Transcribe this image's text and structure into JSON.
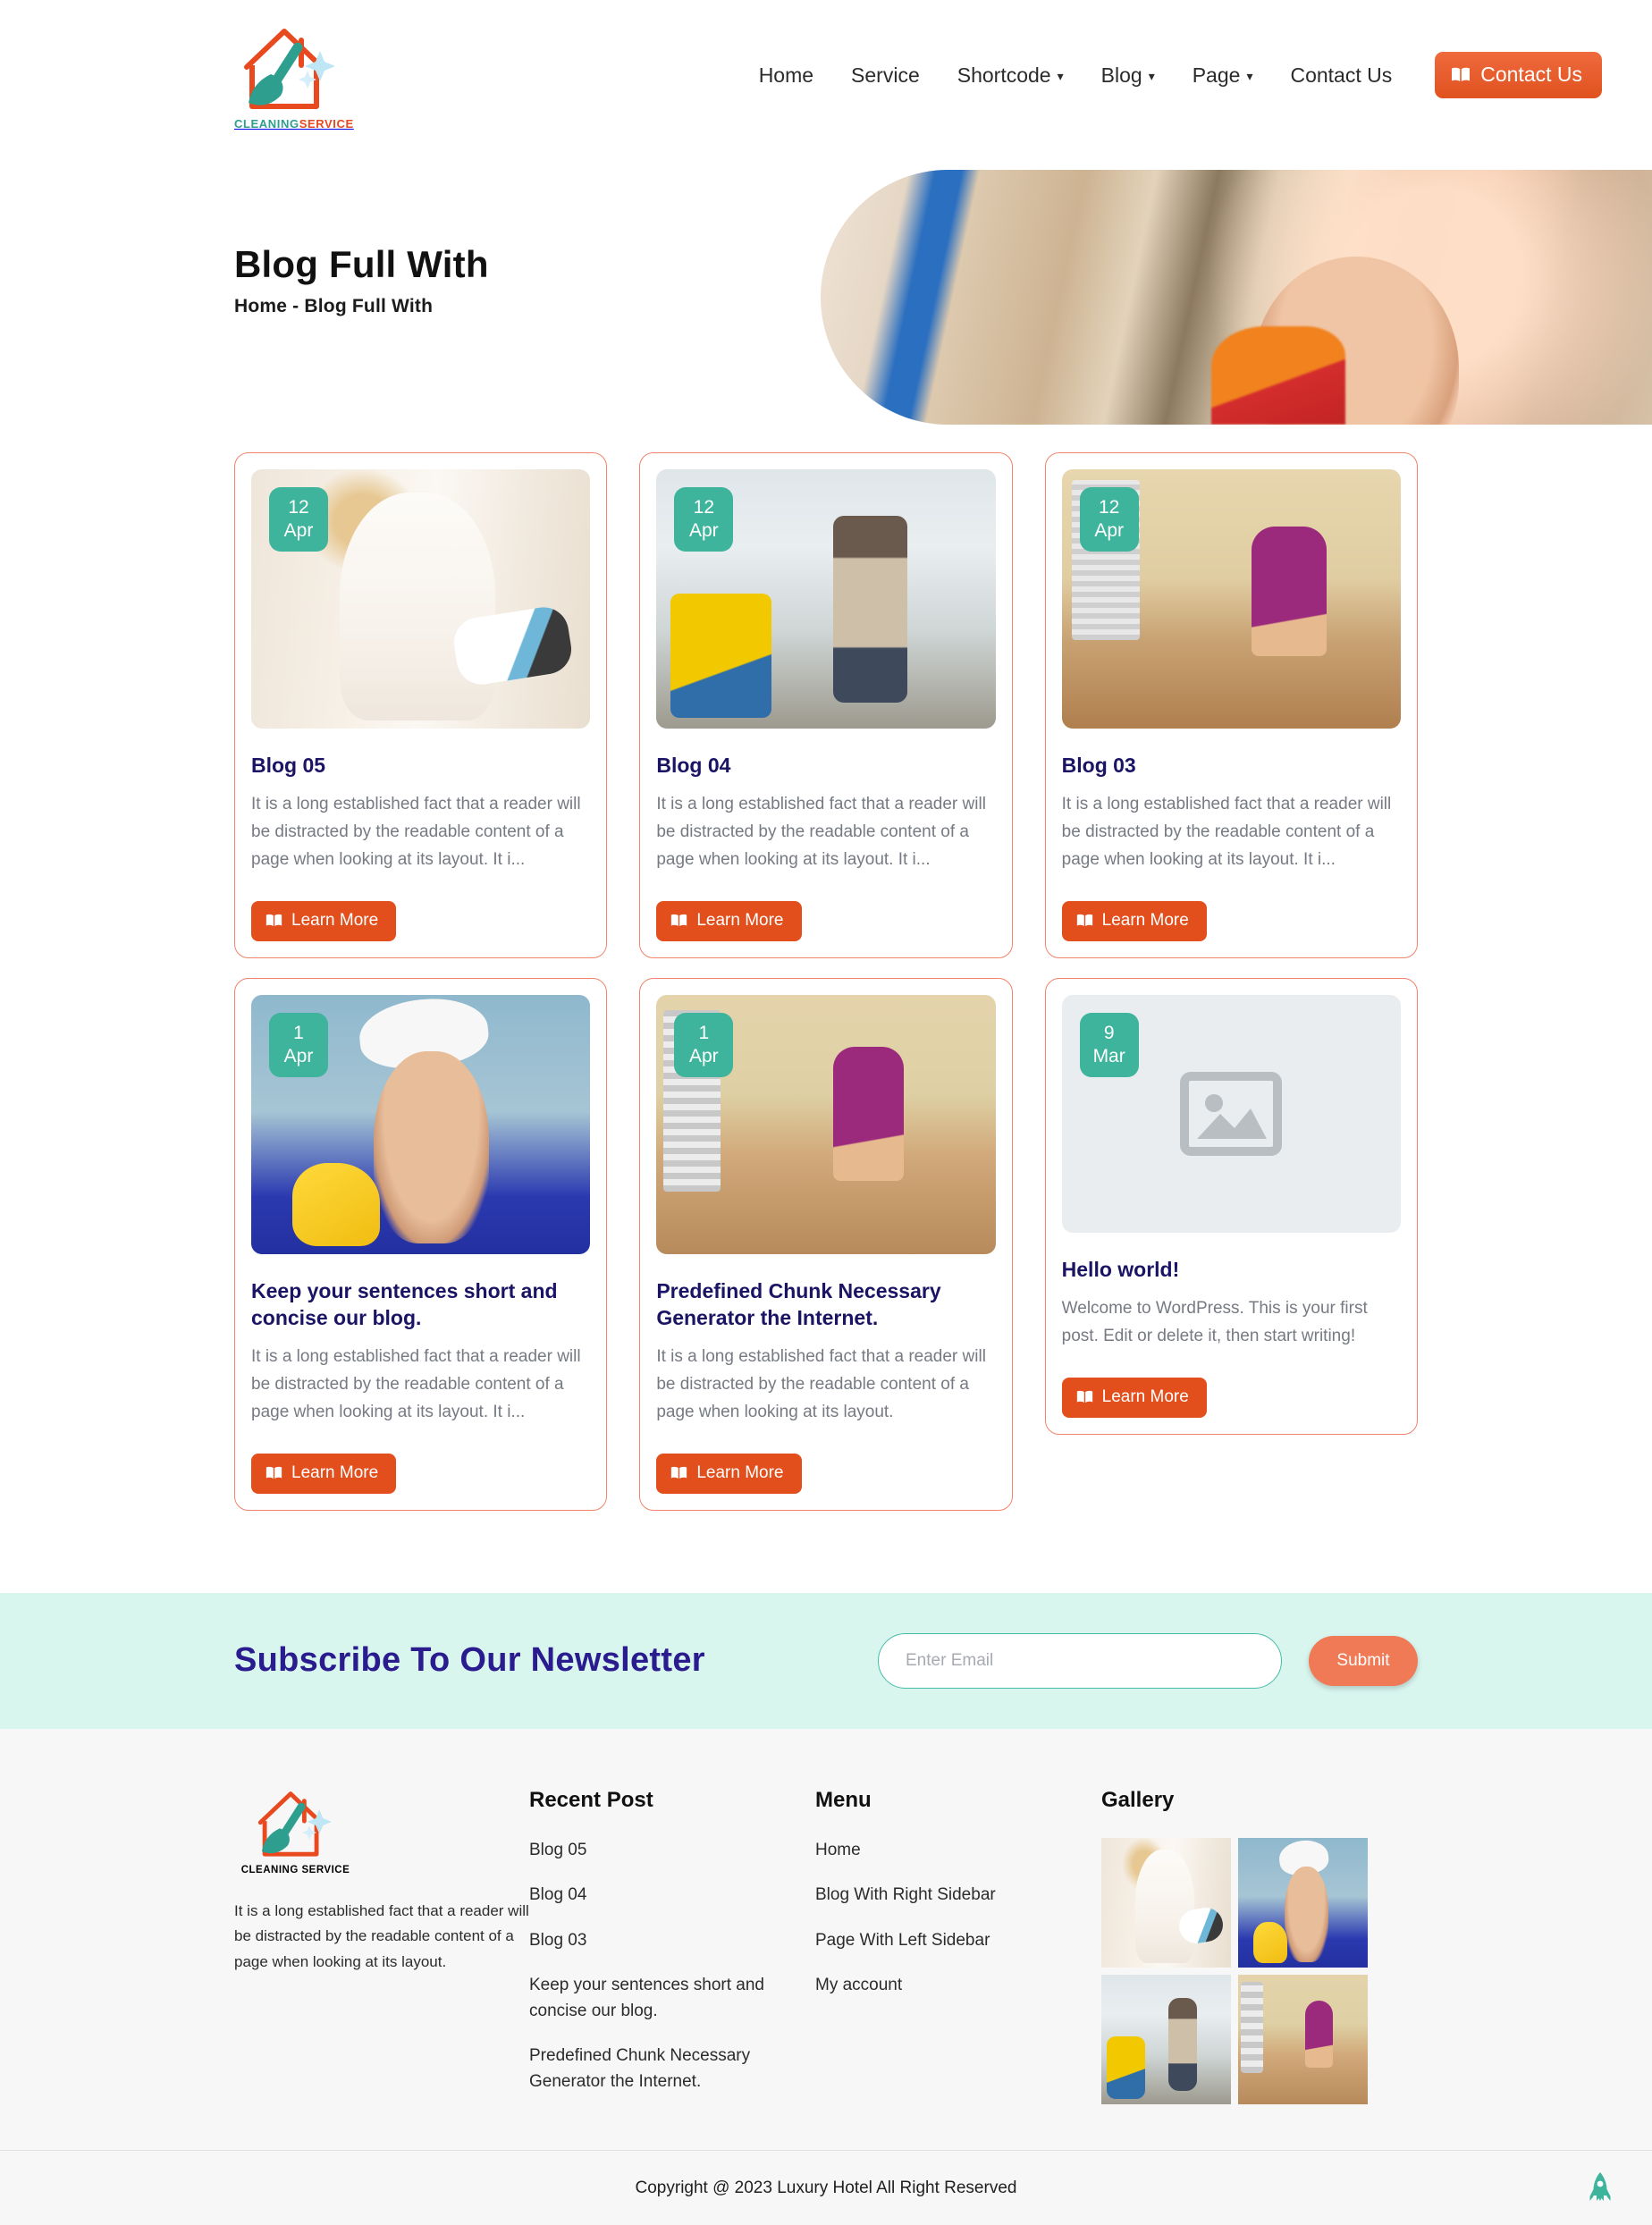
{
  "brand": {
    "name_part1": "CLEANING",
    "name_part2": "SERVICE",
    "logo_icon": "house-broom-sparkle-icon"
  },
  "colors": {
    "orange": "#e24f1d",
    "teal": "#3fb49c",
    "navy": "#1b1464",
    "mint": "#d8f5ee",
    "salmon": "#f07a56"
  },
  "header": {
    "nav": [
      {
        "label": "Home",
        "has_caret": false
      },
      {
        "label": "Service",
        "has_caret": false
      },
      {
        "label": "Shortcode",
        "has_caret": true
      },
      {
        "label": "Blog",
        "has_caret": true
      },
      {
        "label": "Page",
        "has_caret": true
      },
      {
        "label": "Contact Us",
        "has_caret": false
      }
    ],
    "cta_label": "Contact Us",
    "cta_icon": "book-icon"
  },
  "hero": {
    "title": "Blog Full With",
    "breadcrumb": "Home -  Blog Full With",
    "image_alt": "warehouse-worker-photo"
  },
  "blog": {
    "learn_more_label": "Learn More",
    "posts": [
      {
        "day": "12",
        "month": "Apr",
        "title": "Blog 05",
        "excerpt": "It is a long established fact that a reader will be distracted by the readable content of a page when looking at its layout. It i...",
        "photo": "p-dress",
        "placeholder": false
      },
      {
        "day": "12",
        "month": "Apr",
        "title": "Blog 04",
        "excerpt": "It is a long established fact that a reader will be distracted by the readable content of a page when looking at its layout. It i...",
        "photo": "p-corridor",
        "placeholder": false
      },
      {
        "day": "12",
        "month": "Apr",
        "title": "Blog 03",
        "excerpt": "It is a long established fact that a reader will be distracted by the readable content of a page when looking at its layout. It i...",
        "photo": "p-kitchen",
        "placeholder": false
      },
      {
        "day": "1",
        "month": "Apr",
        "title": "Keep your sentences short and concise our blog.",
        "excerpt": "It is a long established fact that a reader will be distracted by the readable content of a page when looking at its layout. It i...",
        "photo": "p-thumbs",
        "placeholder": false
      },
      {
        "day": "1",
        "month": "Apr",
        "title": "Predefined Chunk Necessary Generator the Internet.",
        "excerpt": "It is a long established fact that a reader will be distracted by the readable content of a page when looking at its layout.",
        "photo": "p-kitchen2",
        "placeholder": false
      },
      {
        "day": "9",
        "month": "Mar",
        "title": "Hello world!",
        "excerpt": "Welcome to WordPress. This is your first post. Edit or delete it, then start writing!",
        "photo": "",
        "placeholder": true
      }
    ]
  },
  "newsletter": {
    "title": "Subscribe To Our Newsletter",
    "input_placeholder": "Enter Email",
    "input_value": "",
    "submit_label": "Submit"
  },
  "footer": {
    "about": "It is a long established fact that a reader will be distracted by the readable content of a page when looking at its layout.",
    "recent": {
      "heading": "Recent Post",
      "items": [
        "Blog 05",
        "Blog 04",
        "Blog 03",
        "Keep your sentences short and concise our blog.",
        "Predefined Chunk Necessary Generator the Internet."
      ]
    },
    "menu": {
      "heading": "Menu",
      "items": [
        "Home",
        "Blog With Right Sidebar",
        "Page With Left Sidebar",
        "My account"
      ]
    },
    "gallery": {
      "heading": "Gallery",
      "items": [
        "p-dress",
        "p-thumbs",
        "p-corridor",
        "p-kitchen2"
      ]
    },
    "copyright": "Copyright @ 2023 Luxury Hotel All Right Reserved",
    "scroll_top_icon": "rocket-icon"
  }
}
